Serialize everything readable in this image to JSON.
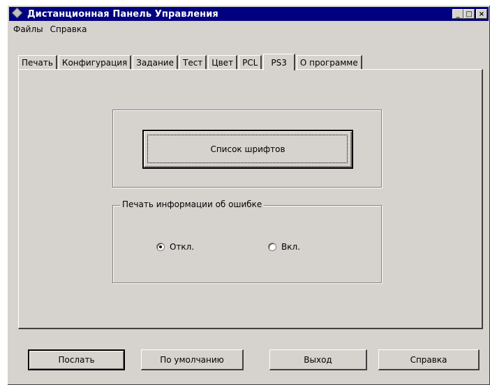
{
  "window": {
    "title": "Дистанционная Панель Управления",
    "controls": {
      "minimize": "_",
      "maximize": "□",
      "close": "×"
    }
  },
  "menu": {
    "items": [
      "Файлы",
      "Справка"
    ]
  },
  "tabs": [
    {
      "label": "Печать"
    },
    {
      "label": "Конфигурация"
    },
    {
      "label": "Задание"
    },
    {
      "label": "Тест"
    },
    {
      "label": "Цвет"
    },
    {
      "label": "PCL"
    },
    {
      "label": "PS3"
    },
    {
      "label": "О программе"
    }
  ],
  "active_tab": "PS3",
  "panel": {
    "fonts_button": "Список шрифтов",
    "error_group": {
      "label": "Печать информации об ошибке",
      "options": [
        {
          "label": "Откл.",
          "checked": true
        },
        {
          "label": "Вкл.",
          "checked": false
        }
      ]
    }
  },
  "buttons": {
    "send": "Послать",
    "default": "По умолчанию",
    "exit": "Выход",
    "help": "Справка"
  }
}
